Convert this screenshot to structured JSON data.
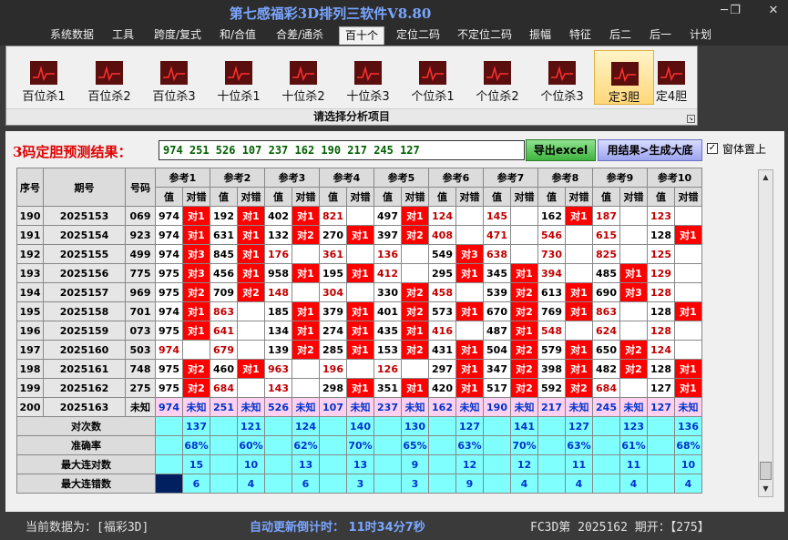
{
  "window": {
    "title": "第七感福彩3D排列三软件V8.80",
    "minimize": "─",
    "maximize": "❐",
    "close": "✕"
  },
  "menu": [
    "系统数据",
    "工具",
    "跨度/复式",
    "和/合值",
    "合差/通杀",
    "百十个",
    "定位二码",
    "不定位二码",
    "振幅",
    "特征",
    "后二",
    "后一",
    "计划"
  ],
  "active_menu": "百十个",
  "ribbon": {
    "buttons": [
      "百位杀1",
      "百位杀2",
      "百位杀3",
      "十位杀1",
      "十位杀2",
      "十位杀3",
      "个位杀1",
      "个位杀2",
      "个位杀3",
      "定3胆",
      "定4胆"
    ],
    "active": "定3胆",
    "caption": "请选择分析项目",
    "icon": "chart-icon",
    "icon_bg": "#5a0e0e",
    "icon_line": "#ff3030"
  },
  "result": {
    "label": "3码定胆预测结果：",
    "value": "974  251  526  107  237  162  190  217  245  127",
    "export_label": "导出excel",
    "gen_label": "用结果>生成大底",
    "ontop_label": "窗体置上",
    "ontop_checked": "✓"
  },
  "table": {
    "col_headers": [
      "序号",
      "期号",
      "号码"
    ],
    "refs": [
      "参考1",
      "参考2",
      "参考3",
      "参考4",
      "参考5",
      "参考6",
      "参考7",
      "参考8",
      "参考9",
      "参考10"
    ],
    "sub_val": "值",
    "sub_hit": "对错",
    "rows": [
      {
        "seq": "190",
        "issue": "2025153",
        "num": "069",
        "c": [
          [
            "974",
            "对1",
            0
          ],
          [
            "192",
            "对1",
            0
          ],
          [
            "402",
            "对1",
            0
          ],
          [
            "821",
            "",
            1
          ],
          [
            "497",
            "对1",
            0
          ],
          [
            "124",
            "",
            1
          ],
          [
            "145",
            "",
            1
          ],
          [
            "162",
            "对1",
            0
          ],
          [
            "187",
            "",
            1
          ],
          [
            "123",
            "",
            1
          ]
        ]
      },
      {
        "seq": "191",
        "issue": "2025154",
        "num": "923",
        "c": [
          [
            "974",
            "对1",
            0
          ],
          [
            "631",
            "对1",
            0
          ],
          [
            "132",
            "对2",
            0
          ],
          [
            "270",
            "对1",
            0
          ],
          [
            "397",
            "对2",
            0
          ],
          [
            "408",
            "",
            1
          ],
          [
            "471",
            "",
            1
          ],
          [
            "546",
            "",
            1
          ],
          [
            "615",
            "",
            1
          ],
          [
            "128",
            "对1",
            0
          ]
        ]
      },
      {
        "seq": "192",
        "issue": "2025155",
        "num": "499",
        "c": [
          [
            "974",
            "对3",
            0
          ],
          [
            "845",
            "对1",
            0
          ],
          [
            "176",
            "",
            1
          ],
          [
            "361",
            "",
            1
          ],
          [
            "136",
            "",
            1
          ],
          [
            "549",
            "对3",
            0
          ],
          [
            "638",
            "",
            1
          ],
          [
            "730",
            "",
            1
          ],
          [
            "825",
            "",
            1
          ],
          [
            "125",
            "",
            1
          ]
        ]
      },
      {
        "seq": "193",
        "issue": "2025156",
        "num": "775",
        "c": [
          [
            "975",
            "对3",
            0
          ],
          [
            "456",
            "对1",
            0
          ],
          [
            "958",
            "对1",
            0
          ],
          [
            "195",
            "对1",
            0
          ],
          [
            "412",
            "",
            1
          ],
          [
            "295",
            "对1",
            0
          ],
          [
            "345",
            "对1",
            0
          ],
          [
            "394",
            "",
            1
          ],
          [
            "485",
            "对1",
            0
          ],
          [
            "129",
            "",
            1
          ]
        ]
      },
      {
        "seq": "194",
        "issue": "2025157",
        "num": "969",
        "c": [
          [
            "975",
            "对2",
            0
          ],
          [
            "709",
            "对2",
            0
          ],
          [
            "148",
            "",
            1
          ],
          [
            "304",
            "",
            1
          ],
          [
            "330",
            "对2",
            0
          ],
          [
            "458",
            "",
            1
          ],
          [
            "539",
            "对2",
            0
          ],
          [
            "613",
            "对1",
            0
          ],
          [
            "690",
            "对3",
            0
          ],
          [
            "128",
            "",
            1
          ]
        ]
      },
      {
        "seq": "195",
        "issue": "2025158",
        "num": "701",
        "c": [
          [
            "974",
            "对1",
            0
          ],
          [
            "863",
            "",
            1
          ],
          [
            "185",
            "对1",
            0
          ],
          [
            "379",
            "对1",
            0
          ],
          [
            "401",
            "对2",
            0
          ],
          [
            "573",
            "对1",
            0
          ],
          [
            "670",
            "对2",
            0
          ],
          [
            "769",
            "对1",
            0
          ],
          [
            "863",
            "",
            1
          ],
          [
            "128",
            "对1",
            0
          ]
        ]
      },
      {
        "seq": "196",
        "issue": "2025159",
        "num": "073",
        "c": [
          [
            "975",
            "对1",
            0
          ],
          [
            "641",
            "",
            1
          ],
          [
            "134",
            "对1",
            0
          ],
          [
            "274",
            "对1",
            0
          ],
          [
            "435",
            "对1",
            0
          ],
          [
            "416",
            "",
            1
          ],
          [
            "487",
            "对1",
            0
          ],
          [
            "548",
            "",
            1
          ],
          [
            "624",
            "",
            1
          ],
          [
            "128",
            "",
            1
          ]
        ]
      },
      {
        "seq": "197",
        "issue": "2025160",
        "num": "503",
        "c": [
          [
            "974",
            "",
            1
          ],
          [
            "679",
            "",
            1
          ],
          [
            "139",
            "对2",
            0
          ],
          [
            "285",
            "对1",
            0
          ],
          [
            "153",
            "对2",
            0
          ],
          [
            "431",
            "对1",
            0
          ],
          [
            "504",
            "对2",
            0
          ],
          [
            "579",
            "对1",
            0
          ],
          [
            "650",
            "对2",
            0
          ],
          [
            "124",
            "",
            1
          ]
        ]
      },
      {
        "seq": "198",
        "issue": "2025161",
        "num": "748",
        "c": [
          [
            "975",
            "对2",
            0
          ],
          [
            "460",
            "对1",
            0
          ],
          [
            "963",
            "",
            1
          ],
          [
            "196",
            "",
            1
          ],
          [
            "126",
            "",
            1
          ],
          [
            "297",
            "对1",
            0
          ],
          [
            "347",
            "对2",
            0
          ],
          [
            "398",
            "对1",
            0
          ],
          [
            "482",
            "对2",
            0
          ],
          [
            "128",
            "对1",
            0
          ]
        ]
      },
      {
        "seq": "199",
        "issue": "2025162",
        "num": "275",
        "c": [
          [
            "975",
            "对2",
            0
          ],
          [
            "684",
            "",
            1
          ],
          [
            "143",
            "",
            1
          ],
          [
            "298",
            "对1",
            0
          ],
          [
            "351",
            "对1",
            0
          ],
          [
            "420",
            "对1",
            0
          ],
          [
            "517",
            "对2",
            0
          ],
          [
            "592",
            "对2",
            0
          ],
          [
            "684",
            "",
            1
          ],
          [
            "127",
            "对1",
            0
          ]
        ]
      }
    ],
    "predict": {
      "seq": "200",
      "issue": "2025163",
      "num": "未知",
      "vals": [
        "974",
        "251",
        "526",
        "107",
        "237",
        "162",
        "190",
        "217",
        "245",
        "127"
      ],
      "hit": "未知"
    },
    "stats": [
      {
        "label": "对次数",
        "vals": [
          "137",
          "121",
          "124",
          "140",
          "130",
          "127",
          "141",
          "127",
          "123",
          "136"
        ]
      },
      {
        "label": "准确率",
        "vals": [
          "68%",
          "60%",
          "62%",
          "70%",
          "65%",
          "63%",
          "70%",
          "63%",
          "61%",
          "68%"
        ]
      },
      {
        "label": "最大连对数",
        "vals": [
          "15",
          "10",
          "13",
          "13",
          "9",
          "12",
          "12",
          "11",
          "11",
          "10"
        ]
      },
      {
        "label": "最大连错数",
        "vals": [
          "6",
          "4",
          "6",
          "3",
          "3",
          "9",
          "4",
          "4",
          "4",
          "4"
        ]
      }
    ]
  },
  "status": {
    "left": "当前数据为：[福彩3D]",
    "mid": "自动更新倒计时：  11时34分7秒",
    "right": "FC3D第 2025162 期开：【275】"
  }
}
